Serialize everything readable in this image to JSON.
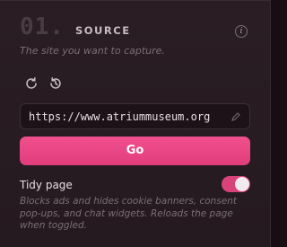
{
  "section": {
    "number": "01.",
    "title": "SOURCE",
    "info_icon": "info-icon",
    "info_glyph": "i",
    "subtitle": "The site you want to capture."
  },
  "toolbar": {
    "icons": [
      "refresh-icon",
      "history-icon"
    ]
  },
  "url_field": {
    "value": "https://www.atriummuseum.org",
    "icon": "pencil-icon"
  },
  "go_button": {
    "label": "Go"
  },
  "tidy_page": {
    "label": "Tidy page",
    "enabled": true,
    "description": "Blocks ads and hides cookie banners, consent pop-ups, and chat widgets. Reloads the page when toggled."
  },
  "colors": {
    "accent": "#e8447f",
    "background": "#2a1e24",
    "text": "#e8dde2",
    "muted": "#7c6e75"
  }
}
